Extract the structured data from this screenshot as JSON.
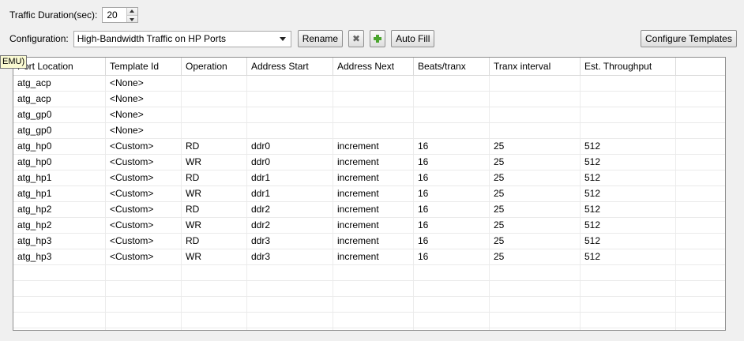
{
  "traffic": {
    "label": "Traffic Duration(sec):",
    "value": "20"
  },
  "config": {
    "label": "Configuration:",
    "selected": "High-Bandwidth Traffic on HP Ports",
    "rename_label": "Rename",
    "autofill_label": "Auto Fill",
    "configure_templates_label": "Configure Templates"
  },
  "tooltip": "EMU)",
  "table": {
    "headers": [
      "Port Location",
      "Template Id",
      "Operation",
      "Address Start",
      "Address Next",
      "Beats/tranx",
      "Tranx interval",
      "Est. Throughput",
      ""
    ],
    "rows": [
      [
        "atg_acp",
        "<None>",
        "",
        "",
        "",
        "",
        "",
        "",
        ""
      ],
      [
        "atg_acp",
        "<None>",
        "",
        "",
        "",
        "",
        "",
        "",
        ""
      ],
      [
        "atg_gp0",
        "<None>",
        "",
        "",
        "",
        "",
        "",
        "",
        ""
      ],
      [
        "atg_gp0",
        "<None>",
        "",
        "",
        "",
        "",
        "",
        "",
        ""
      ],
      [
        "atg_hp0",
        "<Custom>",
        "RD",
        "ddr0",
        "increment",
        "16",
        "25",
        "512",
        ""
      ],
      [
        "atg_hp0",
        "<Custom>",
        "WR",
        "ddr0",
        "increment",
        "16",
        "25",
        "512",
        ""
      ],
      [
        "atg_hp1",
        "<Custom>",
        "RD",
        "ddr1",
        "increment",
        "16",
        "25",
        "512",
        ""
      ],
      [
        "atg_hp1",
        "<Custom>",
        "WR",
        "ddr1",
        "increment",
        "16",
        "25",
        "512",
        ""
      ],
      [
        "atg_hp2",
        "<Custom>",
        "RD",
        "ddr2",
        "increment",
        "16",
        "25",
        "512",
        ""
      ],
      [
        "atg_hp2",
        "<Custom>",
        "WR",
        "ddr2",
        "increment",
        "16",
        "25",
        "512",
        ""
      ],
      [
        "atg_hp3",
        "<Custom>",
        "RD",
        "ddr3",
        "increment",
        "16",
        "25",
        "512",
        ""
      ],
      [
        "atg_hp3",
        "<Custom>",
        "WR",
        "ddr3",
        "increment",
        "16",
        "25",
        "512",
        ""
      ],
      [
        "",
        "",
        "",
        "",
        "",
        "",
        "",
        "",
        ""
      ],
      [
        "",
        "",
        "",
        "",
        "",
        "",
        "",
        "",
        ""
      ],
      [
        "",
        "",
        "",
        "",
        "",
        "",
        "",
        "",
        ""
      ],
      [
        "",
        "",
        "",
        "",
        "",
        "",
        "",
        "",
        ""
      ],
      [
        "",
        "",
        "",
        "",
        "",
        "",
        "",
        "",
        ""
      ]
    ]
  }
}
